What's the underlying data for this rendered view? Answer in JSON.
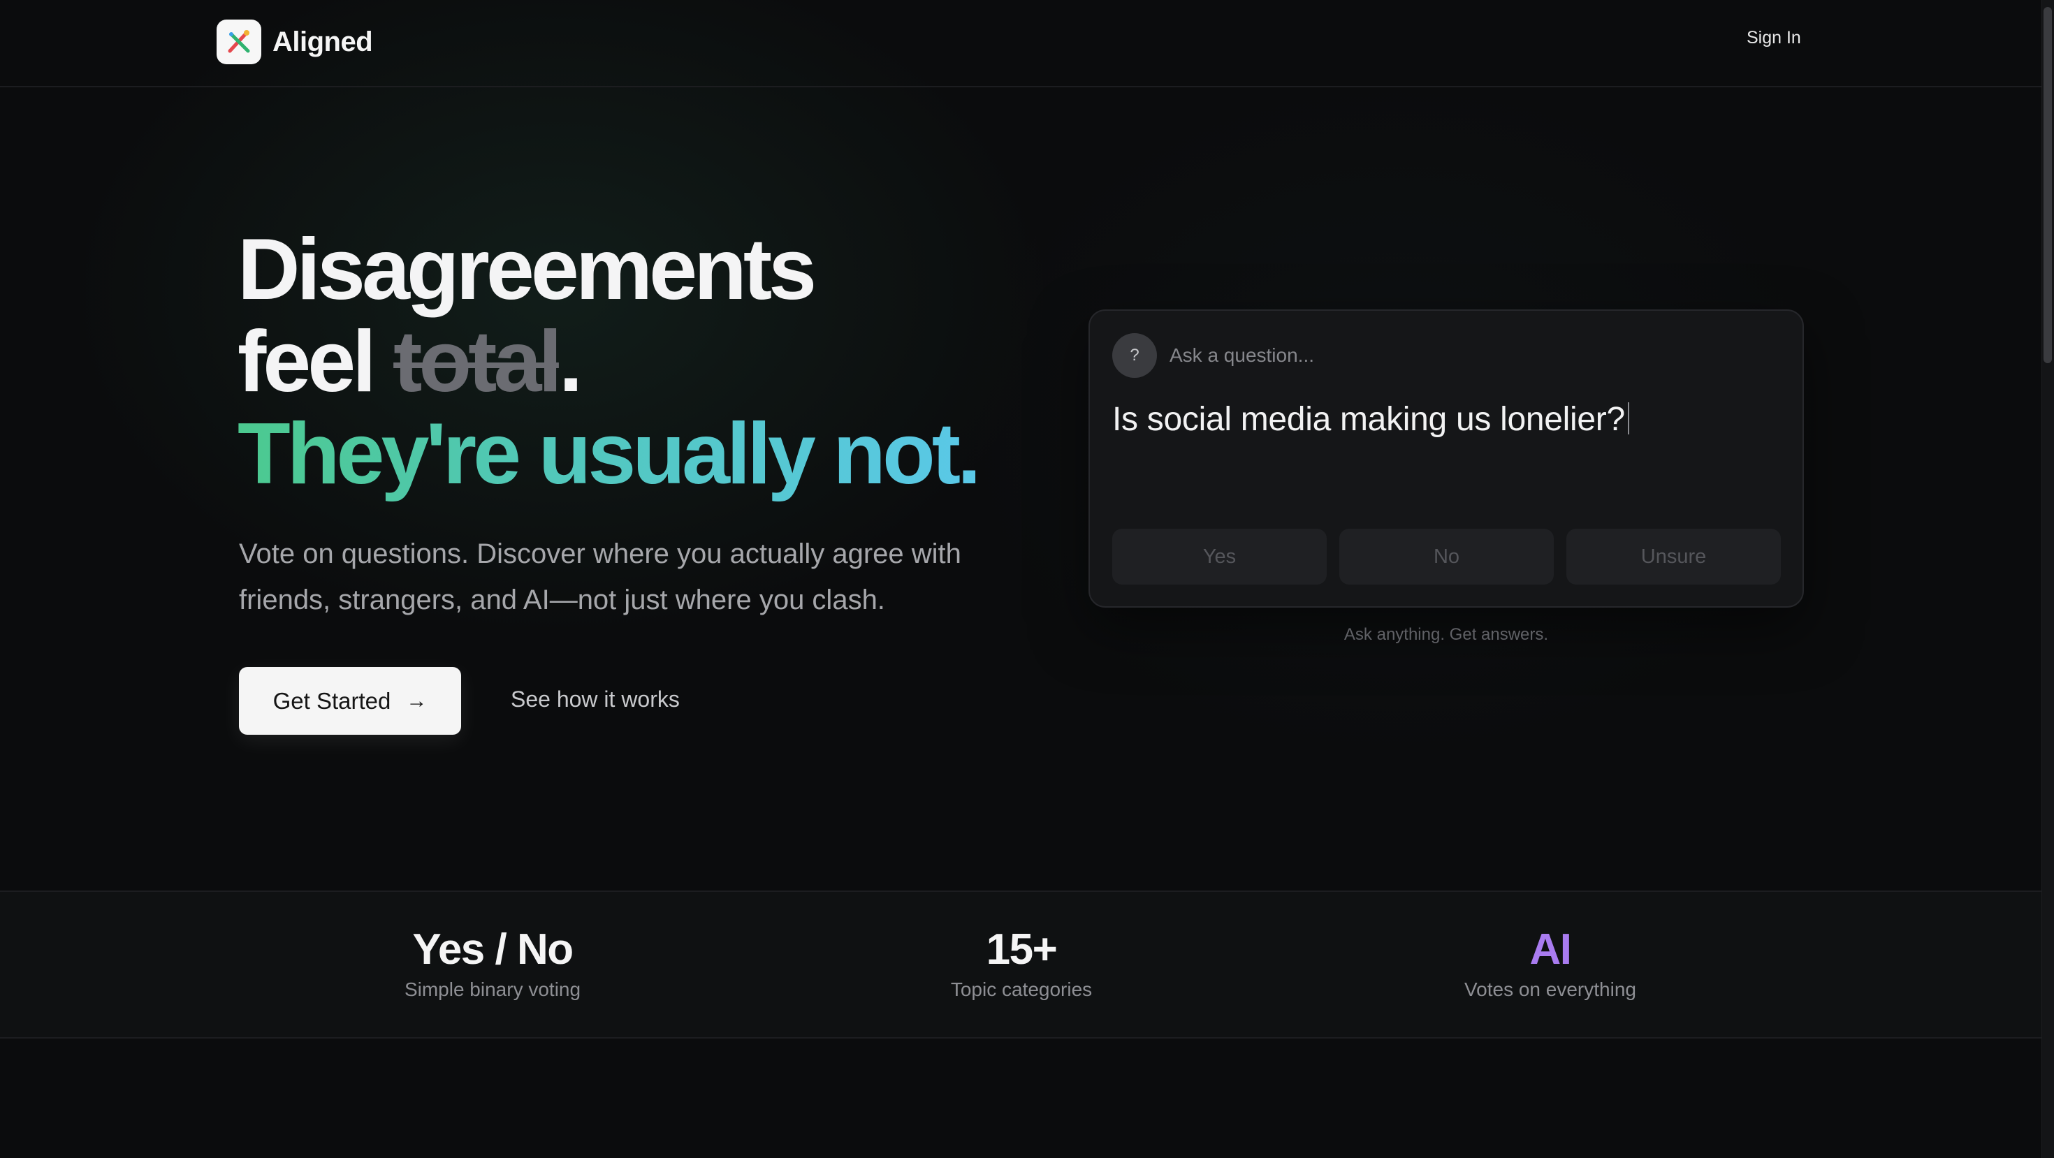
{
  "nav": {
    "brand": "Aligned",
    "sign_in": "Sign In"
  },
  "hero": {
    "line1": "Disagreements",
    "line2_word": "feel",
    "line2_struck": "total",
    "line2_period": ".",
    "line3": "They're usually not.",
    "subtext": "Vote on questions. Discover where you actually agree with friends, strangers, and AI—not just where you clash.",
    "cta_label": "Get Started",
    "cta_arrow": "→",
    "secondary_link": "See how it works"
  },
  "question_card": {
    "icon_glyph": "?",
    "placeholder": "Ask a question...",
    "question": "Is social media making us lonelier?",
    "options": [
      "Yes",
      "No",
      "Unsure"
    ],
    "caption": "Ask anything. Get answers."
  },
  "stats": [
    {
      "value": "Yes / No",
      "label": "Simple binary voting"
    },
    {
      "value": "15+",
      "label": "Topic categories"
    },
    {
      "value": "AI",
      "label": "Votes on everything"
    }
  ],
  "colors": {
    "accent_green": "#4cc98f",
    "accent_cyan": "#5ac8e8",
    "accent_purple": "#a97cf0",
    "background": "#0b0c0d"
  }
}
